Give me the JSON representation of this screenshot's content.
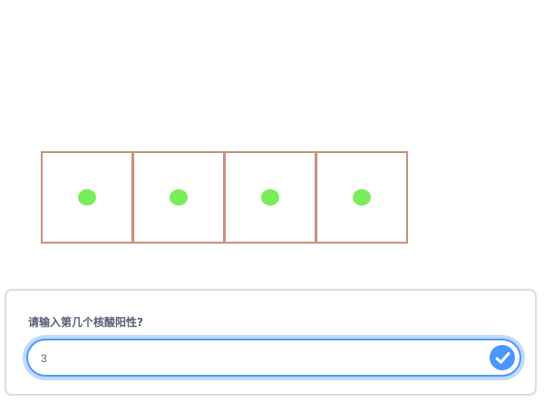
{
  "grid": {
    "cells": [
      {
        "marker": "green-dot"
      },
      {
        "marker": "green-dot"
      },
      {
        "marker": "green-dot"
      },
      {
        "marker": "green-dot"
      }
    ],
    "border_color": "#c8917b",
    "dot_color": "#79ec5a"
  },
  "ask_dialog": {
    "prompt": "请输入第几个核酸阳性?",
    "answer_value": "3",
    "accent_color": "#4c97ff",
    "submit_icon": "check-icon"
  }
}
